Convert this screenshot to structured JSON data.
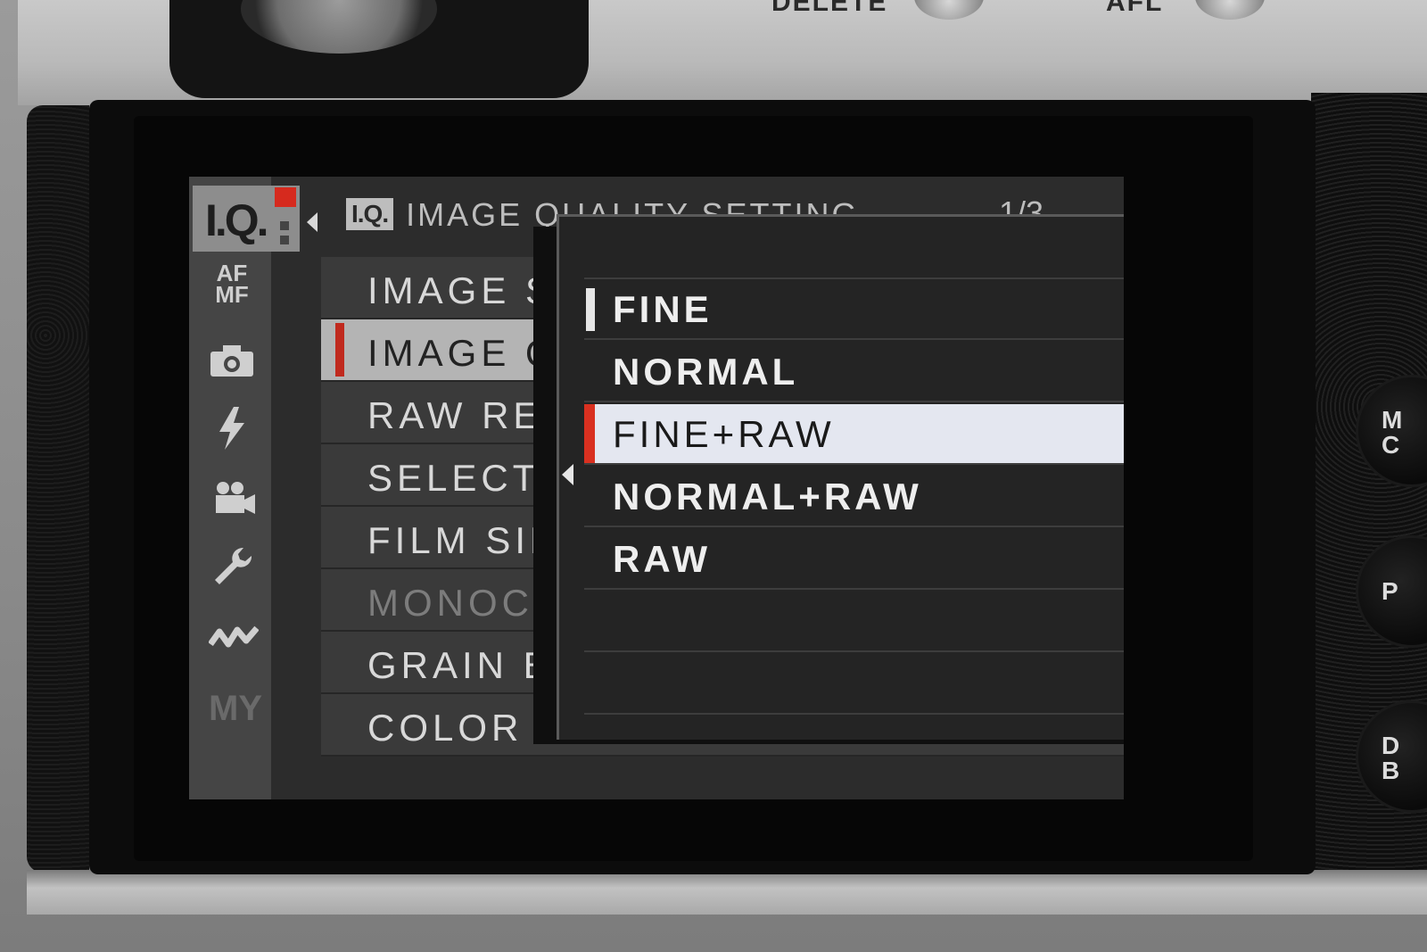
{
  "camera": {
    "top_labels": [
      "DELETE",
      "AFL"
    ],
    "side_buttons": [
      "M\nC",
      "P",
      "D\nB"
    ]
  },
  "menu": {
    "active_tab": "I.Q.",
    "tabs": [
      {
        "name": "iq-tab",
        "label": "I.Q."
      },
      {
        "name": "af-mf-tab",
        "label": "AF\nMF"
      },
      {
        "name": "shooting-tab",
        "icon": "camera-icon"
      },
      {
        "name": "flash-tab",
        "icon": "flash-icon"
      },
      {
        "name": "movie-tab",
        "icon": "movie-camera-icon"
      },
      {
        "name": "setup-tab",
        "icon": "wrench-icon"
      },
      {
        "name": "connection-tab",
        "icon": "wave-icon"
      },
      {
        "name": "my-menu-tab",
        "label": "MY"
      }
    ],
    "header_badge": "I.Q.",
    "header_title": "IMAGE QUALITY SETTING",
    "page_indicator": "1/3",
    "items": [
      {
        "label": "IMAGE SIZE",
        "state": "normal"
      },
      {
        "label": "IMAGE QUALITY",
        "state": "selected"
      },
      {
        "label": "RAW RECORDING",
        "state": "normal"
      },
      {
        "label": "SELECT JPEG/HEIF",
        "state": "normal"
      },
      {
        "label": "FILM SIMULATION",
        "state": "normal"
      },
      {
        "label": "MONOCHROMATIC COLOR",
        "state": "disabled"
      },
      {
        "label": "GRAIN EFFECT",
        "state": "normal"
      },
      {
        "label": "COLOR CHROME EFFECT",
        "state": "normal"
      }
    ]
  },
  "popup": {
    "options": [
      "",
      "FINE",
      "NORMAL",
      "FINE+RAW",
      "NORMAL+RAW",
      "RAW",
      "",
      ""
    ],
    "current_option": "FINE",
    "highlighted_option": "FINE+RAW"
  },
  "colors": {
    "accent_red": "#d62a1e",
    "highlight_bg": "#e4e7f0",
    "menu_bg": "#2c2c2c"
  }
}
